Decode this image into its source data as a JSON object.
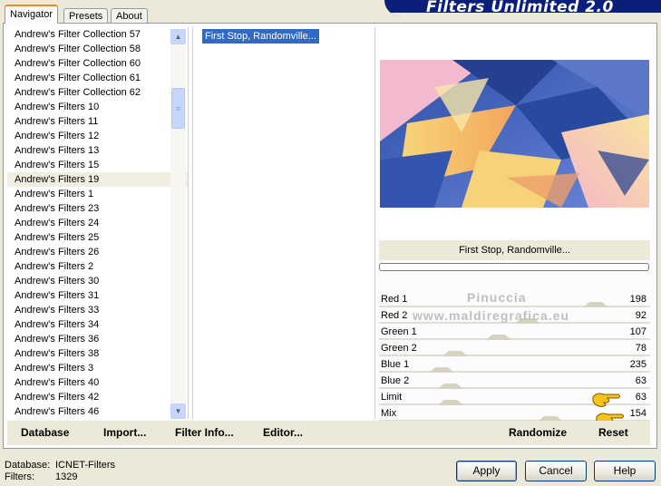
{
  "app_title": "Filters Unlimited 2.0",
  "tabs": [
    "Navigator",
    "Presets",
    "About"
  ],
  "categories": [
    {
      "label": "Andrew's Filter Collection 57",
      "selected": false
    },
    {
      "label": "Andrew's Filter Collection 58",
      "selected": false
    },
    {
      "label": "Andrew's Filter Collection 60",
      "selected": false
    },
    {
      "label": "Andrew's Filter Collection 61",
      "selected": false
    },
    {
      "label": "Andrew's Filter Collection 62",
      "selected": false
    },
    {
      "label": "Andrew's Filters 10",
      "selected": false
    },
    {
      "label": "Andrew's Filters 11",
      "selected": false
    },
    {
      "label": "Andrew's Filters 12",
      "selected": false
    },
    {
      "label": "Andrew's Filters 13",
      "selected": false
    },
    {
      "label": "Andrew's Filters 15",
      "selected": false
    },
    {
      "label": "Andrew's Filters 19",
      "selected": true
    },
    {
      "label": "Andrew's Filters 1",
      "selected": false
    },
    {
      "label": "Andrew's Filters 23",
      "selected": false
    },
    {
      "label": "Andrew's Filters 24",
      "selected": false
    },
    {
      "label": "Andrew's Filters 25",
      "selected": false
    },
    {
      "label": "Andrew's Filters 26",
      "selected": false
    },
    {
      "label": "Andrew's Filters 2",
      "selected": false
    },
    {
      "label": "Andrew's Filters 30",
      "selected": false
    },
    {
      "label": "Andrew's Filters 31",
      "selected": false
    },
    {
      "label": "Andrew's Filters 33",
      "selected": false
    },
    {
      "label": "Andrew's Filters 34",
      "selected": false
    },
    {
      "label": "Andrew's Filters 36",
      "selected": false
    },
    {
      "label": "Andrew's Filters 38",
      "selected": false
    },
    {
      "label": "Andrew's Filters 3",
      "selected": false
    },
    {
      "label": "Andrew's Filters 40",
      "selected": false
    },
    {
      "label": "Andrew's Filters 42",
      "selected": false
    },
    {
      "label": "Andrew's Filters 46",
      "selected": false
    }
  ],
  "filters": [
    "First Stop, Randomville..."
  ],
  "selected_filter_title": "First Stop, Randomville...",
  "parameters": [
    {
      "label": "Red 1",
      "value": "198"
    },
    {
      "label": "Red 2",
      "value": "92"
    },
    {
      "label": "Green 1",
      "value": "107"
    },
    {
      "label": "Green 2",
      "value": "78"
    },
    {
      "label": "Blue 1",
      "value": "235"
    },
    {
      "label": "Blue 2",
      "value": "63"
    },
    {
      "label": "Limit",
      "value": "63"
    },
    {
      "label": "Mix",
      "value": "154"
    }
  ],
  "watermark": {
    "line1": "Pinuccia",
    "line2": "www.maldiregrafica.eu"
  },
  "toolbar": {
    "database": "Database",
    "import": "Import...",
    "filter_info": "Filter Info...",
    "editor": "Editor...",
    "randomize": "Randomize",
    "reset": "Reset"
  },
  "status": {
    "database_label": "Database:",
    "database_value": "ICNET-Filters",
    "filters_label": "Filters:",
    "filters_value": "1329"
  },
  "buttons": {
    "apply": "Apply",
    "cancel": "Cancel",
    "help": "Help"
  },
  "icons": {
    "scroll_up": "chevron-up-icon",
    "scroll_down": "chevron-down-icon",
    "pointer": "pointing-hand-icon"
  }
}
